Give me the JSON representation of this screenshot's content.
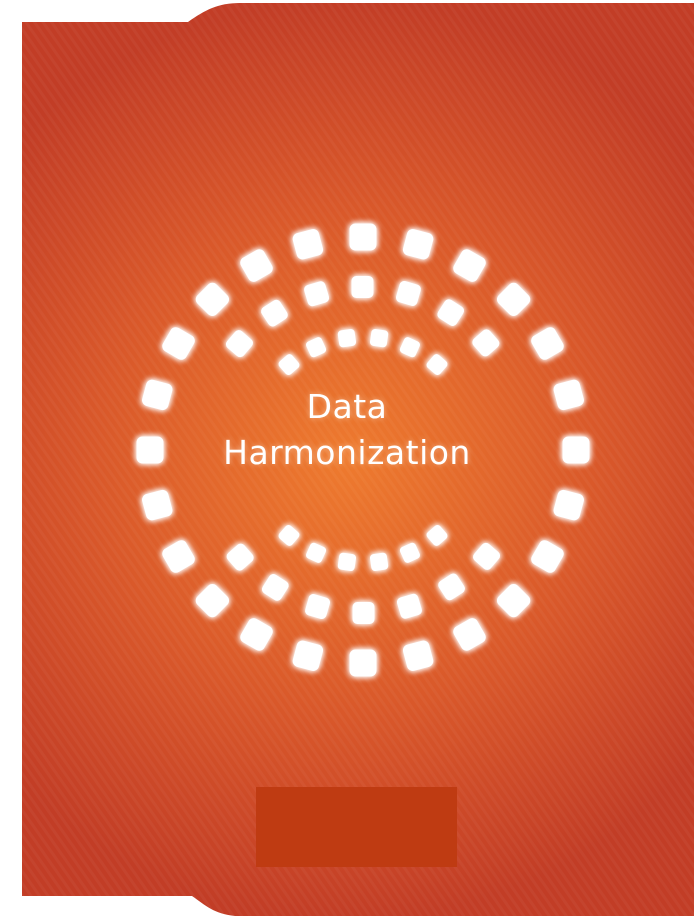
{
  "title": {
    "line1": "Data",
    "line2": "Harmonization"
  },
  "colors": {
    "background_center": "#ee7a2e",
    "background_mid": "#d9582a",
    "background_edge": "#c23d26",
    "footer_box": "#bf3b12",
    "squares": "#ffffff",
    "page": "#ffffff"
  },
  "icons": {
    "logo": "concentric-squares-ring-icon"
  }
}
